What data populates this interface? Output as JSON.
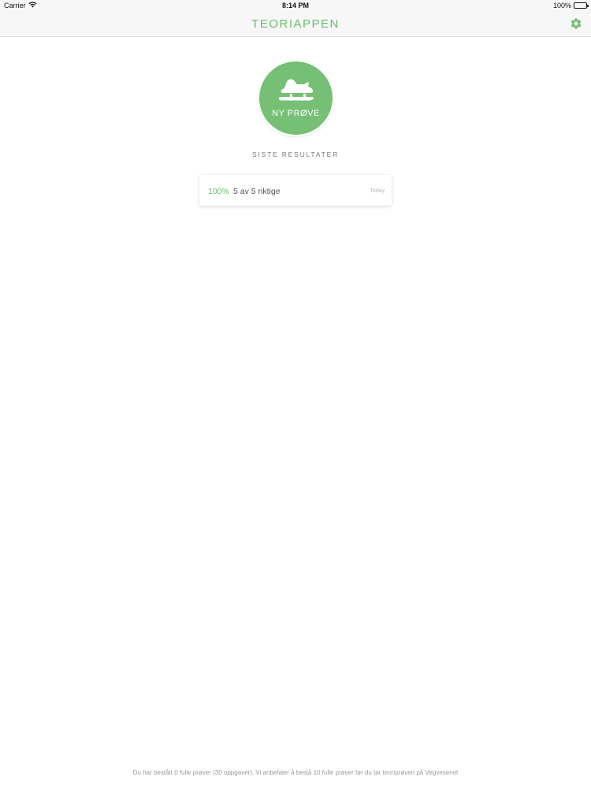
{
  "status_bar": {
    "carrier": "Carrier",
    "time": "8:14 PM",
    "battery": "100%",
    "icons": [
      "wifi-icon",
      "battery-icon"
    ]
  },
  "nav": {
    "title": "TEORIAPPEN",
    "settings_icon": "gear-icon"
  },
  "new_test": {
    "label": "NY PRØVE",
    "icon": "snowmobile-icon"
  },
  "results": {
    "title": "SISTE RESULTATER",
    "items": [
      {
        "percent": "100%",
        "text": "5 av 5 riktige",
        "date": "Today"
      }
    ]
  },
  "footer": {
    "note": "Du har bestått 0 fulle prøver (30 oppgaver). Vi anbefaler å bestå 10 fulle prøver før du tar teoriprøven på Vegvesenet"
  },
  "colors": {
    "accent": "#6cbb6c",
    "button_fill": "#76c076",
    "bar_background": "#f7f7f7"
  }
}
